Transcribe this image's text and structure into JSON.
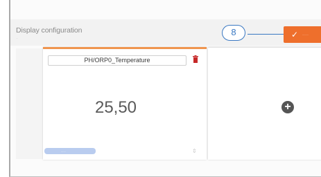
{
  "page": {
    "title": "Display configuration",
    "subtitle": "..."
  },
  "callout": {
    "number": "8"
  },
  "toolbar": {
    "save_icon": "✓",
    "save_label": "........",
    "accent_color": "#ee6f2c"
  },
  "widget": {
    "sensor_name": "PH/ORP0_Temperature",
    "value": "25,50",
    "slider_label": "......",
    "delete_icon": "trash-icon",
    "resize_icon": "resize-handle-icon"
  },
  "add_panel": {
    "add_icon": "+"
  }
}
